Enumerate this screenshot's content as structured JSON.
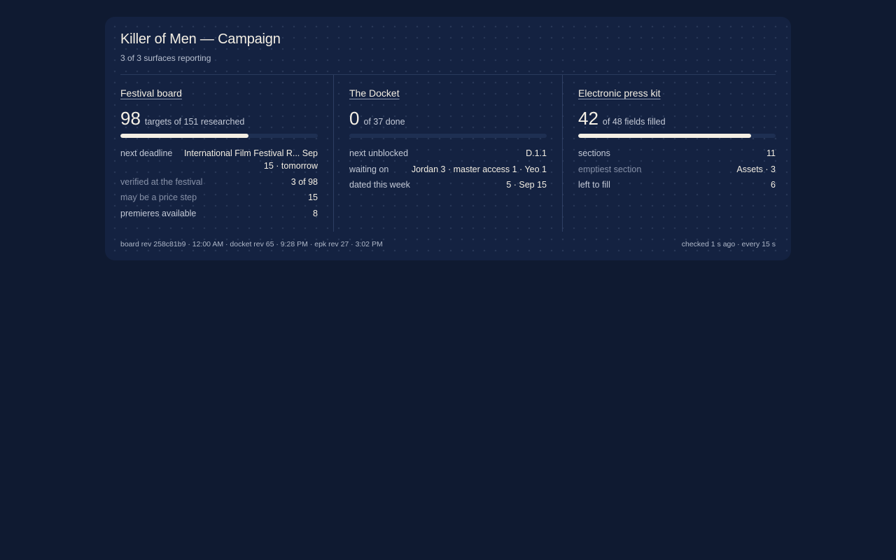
{
  "header": {
    "title": "Killer of Men — Campaign",
    "subtitle": "3 of 3 surfaces reporting"
  },
  "panels": [
    {
      "title": "Festival board",
      "metric": 98,
      "metric_label": "targets of 151 researched",
      "progress": 0.649,
      "rows": [
        {
          "key": "next deadline",
          "value": "International Film Festival R... Sep 15 · tomorrow",
          "dim": false
        },
        {
          "key": "verified at the festival",
          "value": "3 of 98",
          "dim": true
        },
        {
          "key": "may be a price step",
          "value": "15",
          "dim": true
        },
        {
          "key": "premieres available",
          "value": "8",
          "dim": false
        }
      ]
    },
    {
      "title": "The Docket",
      "metric": 0,
      "metric_label": "of 37 done",
      "progress": 0,
      "rows": [
        {
          "key": "next unblocked",
          "value": "D.1.1",
          "dim": false
        },
        {
          "key": "waiting on",
          "value": "Jordan 3 · master access 1 · Yeo 1",
          "dim": false
        },
        {
          "key": "dated this week",
          "value": "5 · Sep 15",
          "dim": false
        }
      ]
    },
    {
      "title": "Electronic press kit",
      "metric": 42,
      "metric_label": "of 48 fields filled",
      "progress": 0.875,
      "rows": [
        {
          "key": "sections",
          "value": "11",
          "dim": false
        },
        {
          "key": "emptiest section",
          "value": "Assets · 3",
          "dim": true
        },
        {
          "key": "left to fill",
          "value": "6",
          "dim": false
        }
      ]
    }
  ],
  "footer": {
    "revisions": "board rev 258c81b9 · 12:00 AM · docket rev 65 · 9:28 PM · epk rev 27 · 3:02 PM",
    "status": "checked 1 s ago · every 15 s"
  },
  "colors": {
    "background": "#0f1a31",
    "card": "#142241",
    "bar_fill": "#f4efe4",
    "bar_track": "#1e2f52"
  }
}
